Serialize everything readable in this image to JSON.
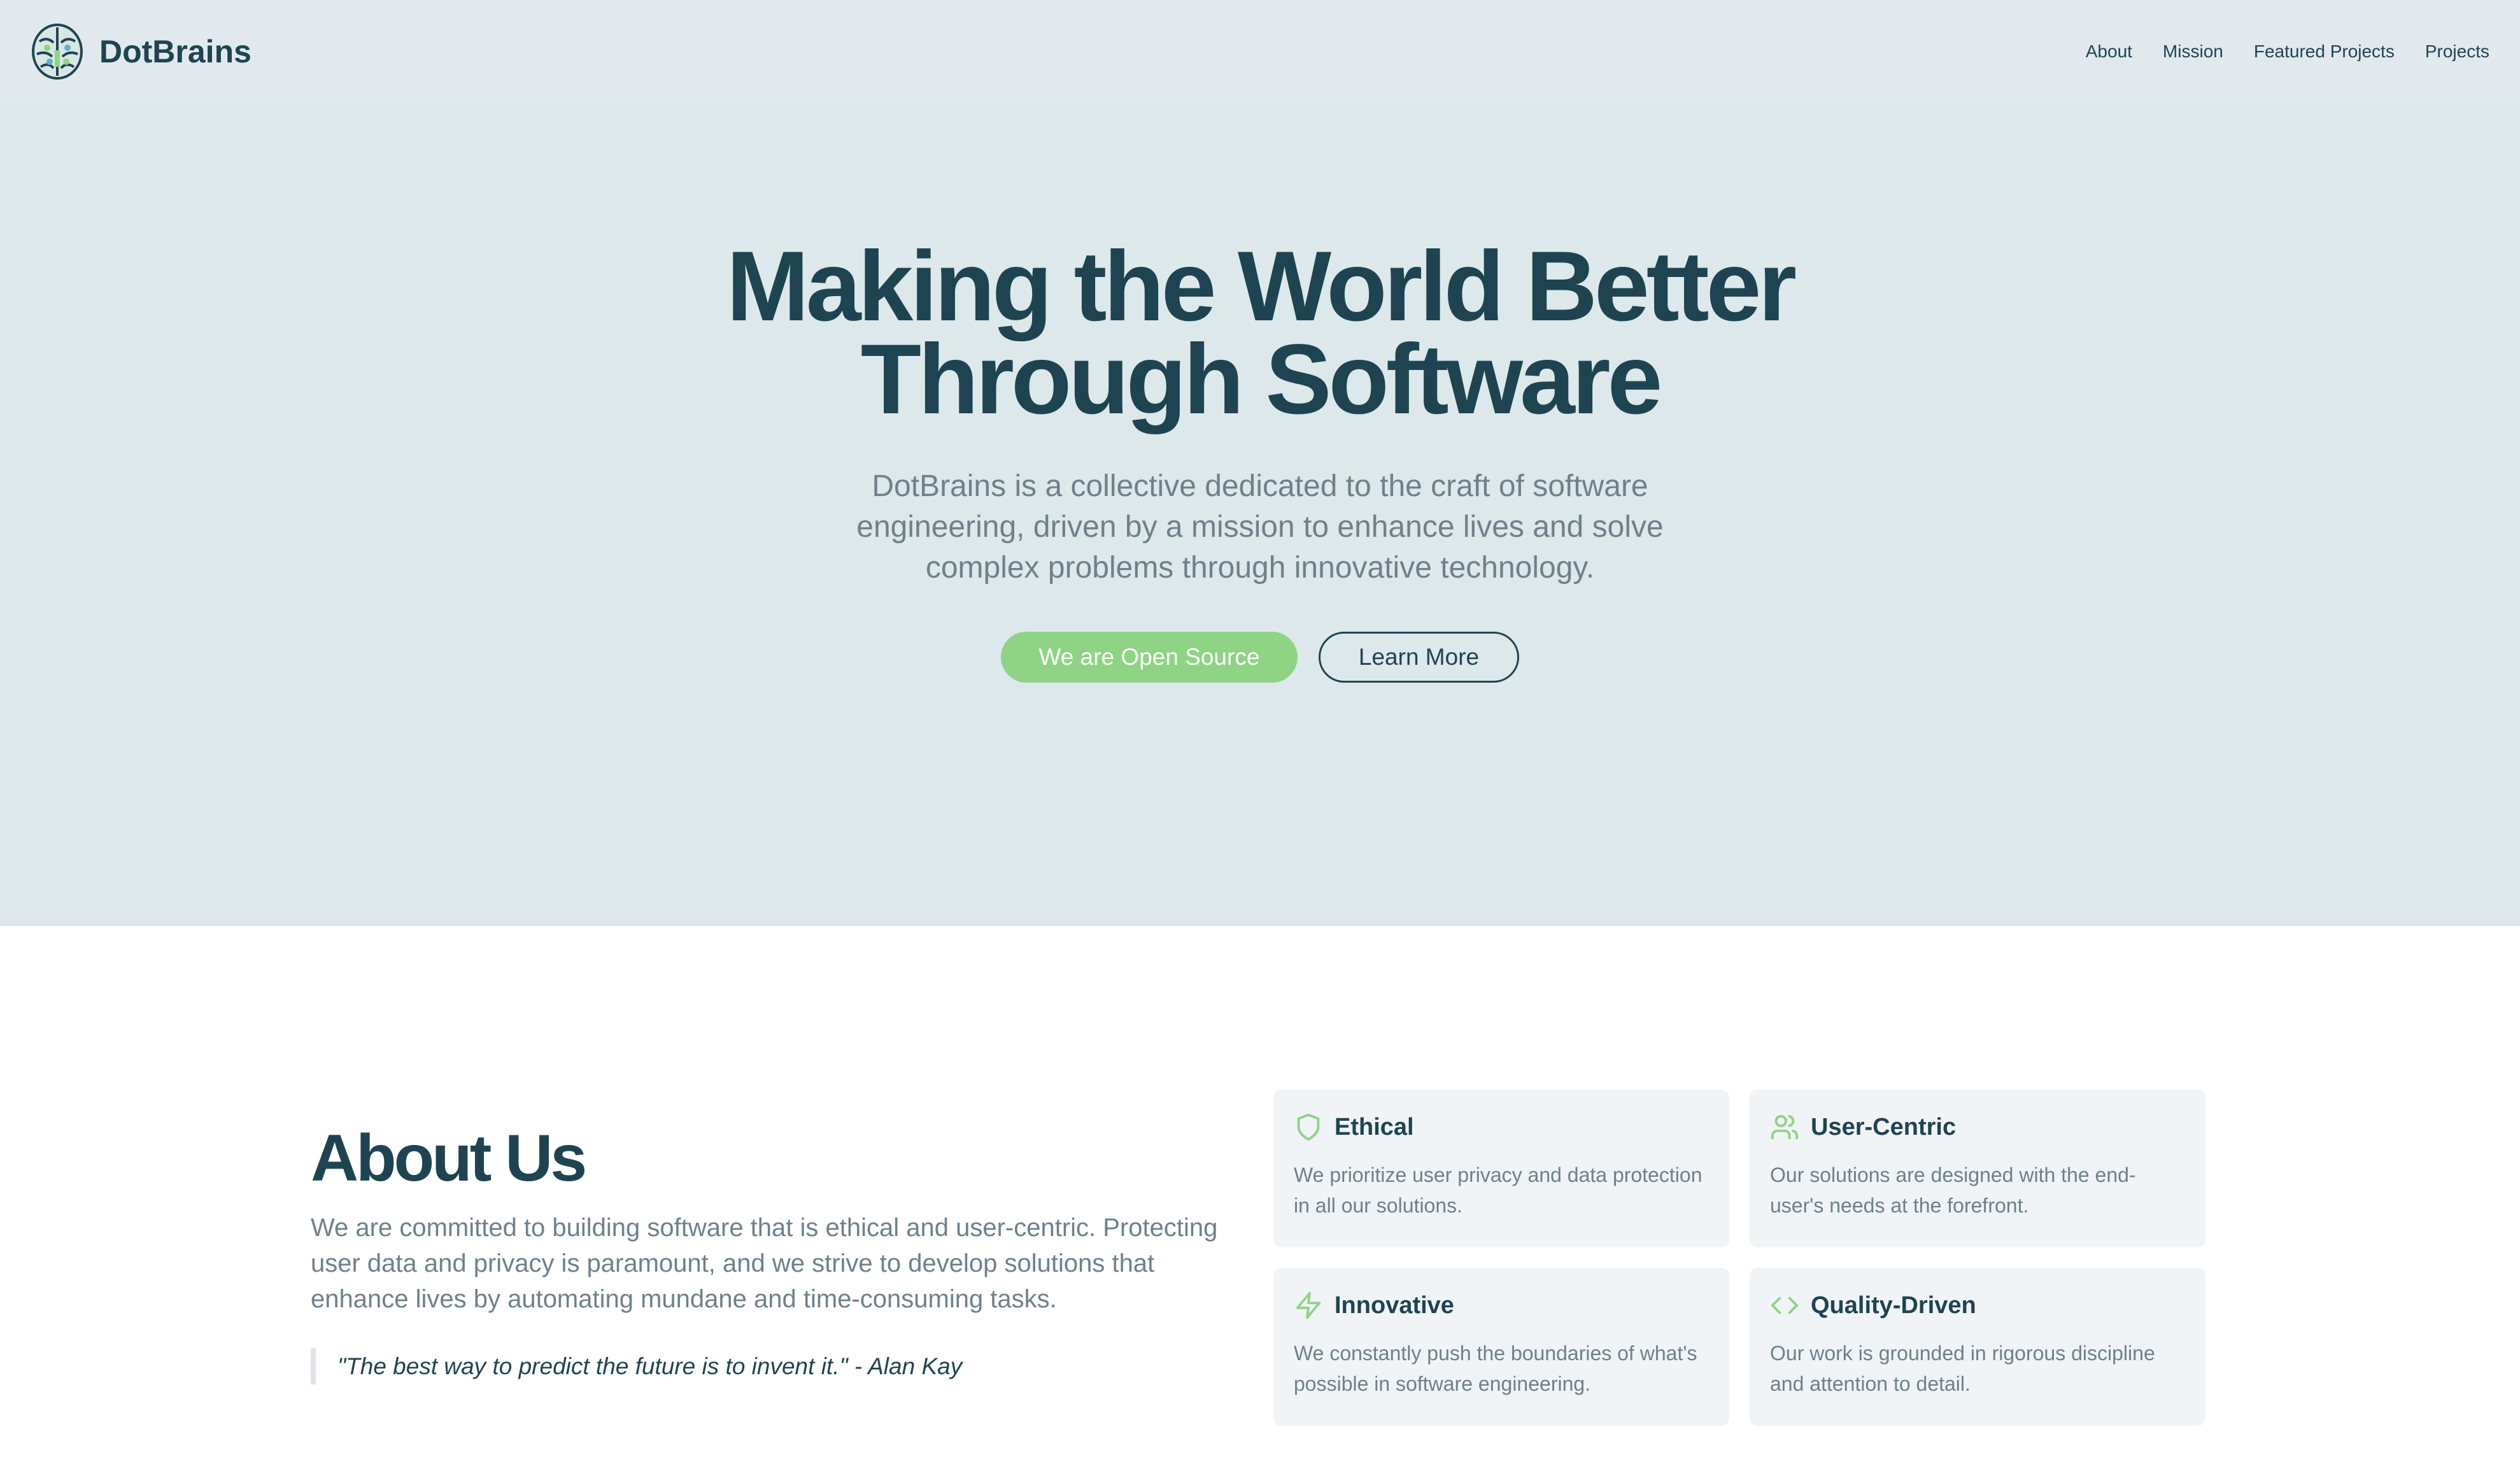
{
  "header": {
    "brand": "DotBrains",
    "logo_icon": "brain-icon",
    "nav": [
      "About",
      "Mission",
      "Featured Projects",
      "Projects"
    ]
  },
  "hero": {
    "title_line1": "Making the World Better",
    "title_line2": "Through Software",
    "subtitle": "DotBrains is a collective dedicated to the craft of software engineering, driven by a mission to enhance lives and solve complex problems through innovative technology.",
    "primary_button": "We are Open Source",
    "secondary_button": "Learn More"
  },
  "about": {
    "title": "About Us",
    "text": "We are committed to building software that is ethical and user-centric. Protecting user data and privacy is paramount, and we strive to develop solutions that enhance lives by automating mundane and time-consuming tasks.",
    "quote": "\"The best way to predict the future is to invent it.\" - Alan Kay",
    "cards": [
      {
        "icon": "shield-icon",
        "title": "Ethical",
        "desc": "We prioritize user privacy and data protection in all our solutions."
      },
      {
        "icon": "users-icon",
        "title": "User-Centric",
        "desc": "Our solutions are designed with the end-user's needs at the forefront."
      },
      {
        "icon": "lightning-icon",
        "title": "Innovative",
        "desc": "We constantly push the boundaries of what's possible in software engineering."
      },
      {
        "icon": "code-icon",
        "title": "Quality-Driven",
        "desc": "Our work is grounded in rigorous discipline and attention to detail."
      }
    ]
  },
  "colors": {
    "primary_dark": "#1f4451",
    "accent_green": "#8fd484",
    "muted_text": "#6e818b",
    "header_bg": "#e1e9ef",
    "hero_bg": "#dde9ea",
    "card_bg": "#f0f4f6"
  }
}
